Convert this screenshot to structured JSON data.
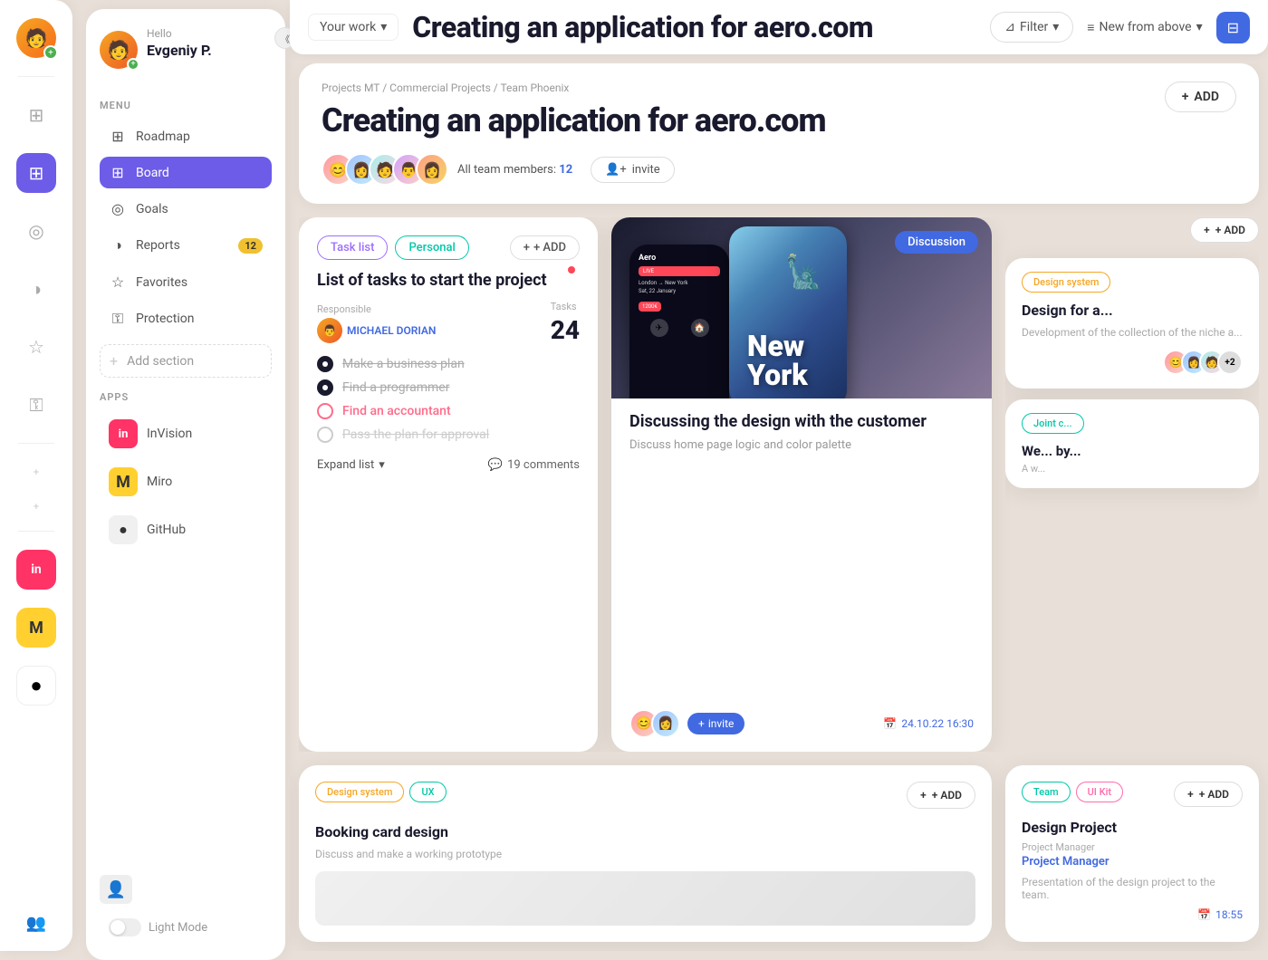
{
  "app": {
    "title": "Creating an application for aero.com",
    "breadcrumb": [
      "Projects MT",
      "Commercial Projects",
      "Team Phoenix"
    ],
    "your_work_label": "Your work",
    "filter_label": "Filter",
    "sort_label": "New from above",
    "all_members_label": "All team members:",
    "all_members_count": "12"
  },
  "sidebar": {
    "hello_label": "Hello",
    "username": "Evgeniy P.",
    "menu_label": "MENU",
    "items": [
      {
        "label": "Roadmap",
        "icon": "⊞",
        "active": false
      },
      {
        "label": "Board",
        "icon": "⊞",
        "active": true
      },
      {
        "label": "Goals",
        "icon": "◎",
        "active": false
      },
      {
        "label": "Reports",
        "icon": "◑",
        "active": false,
        "badge": "12"
      },
      {
        "label": "Favorites",
        "icon": "☆",
        "active": false
      },
      {
        "label": "Protection",
        "icon": "⚿",
        "active": false
      }
    ],
    "add_section_label": "Add section",
    "apps_label": "APPS",
    "apps": [
      {
        "label": "InVision",
        "icon": "in",
        "type": "invision"
      },
      {
        "label": "Miro",
        "icon": "M",
        "type": "miro"
      },
      {
        "label": "GitHub",
        "icon": "●",
        "type": "github"
      }
    ],
    "light_mode_label": "Light Mode"
  },
  "task_card": {
    "tags": [
      "Task list",
      "Personal"
    ],
    "add_label": "+ ADD",
    "discussion_tag": "Discussion",
    "title": "List of tasks to start the project",
    "responsible_label": "Responsible",
    "responsible_name": "MICHAEL DORIAN",
    "tasks_label": "Tasks",
    "tasks_count": "24",
    "items": [
      {
        "text": "Make a business plan",
        "done": true,
        "active": false
      },
      {
        "text": "Find a programmer",
        "done": true,
        "active": false
      },
      {
        "text": "Find an accountant",
        "done": false,
        "active": true
      },
      {
        "text": "Pass the plan for approval",
        "done": false,
        "active": false,
        "pending": true
      }
    ],
    "expand_label": "Expand list",
    "comments_label": "19 comments"
  },
  "discussion_card": {
    "tag": "Discussion",
    "title": "Discussing the design with the customer",
    "desc": "Discuss home page logic and color palette",
    "date": "24.10.22  16:30",
    "invite_label": "invite"
  },
  "right_cards": {
    "design_for_a": {
      "tag": "Design system",
      "title": "Design for a...",
      "desc": "Development of the collection of the niche a..."
    },
    "joint": {
      "tag": "Joint c...",
      "title": "We... by...",
      "desc": "A w..."
    },
    "add_label": "+ ADD"
  },
  "bottom_cards": {
    "booking": {
      "tags": [
        "Design system",
        "UX"
      ],
      "add_label": "+ ADD",
      "title": "Booking card design",
      "desc": "Discuss and make a working prototype"
    },
    "design_project": {
      "tags": [
        "Team",
        "UI Kit"
      ],
      "title": "Design Project",
      "manager_label": "Project Manager",
      "manager_name": "Presentation of the design project to the team.",
      "time": "18:55"
    }
  }
}
